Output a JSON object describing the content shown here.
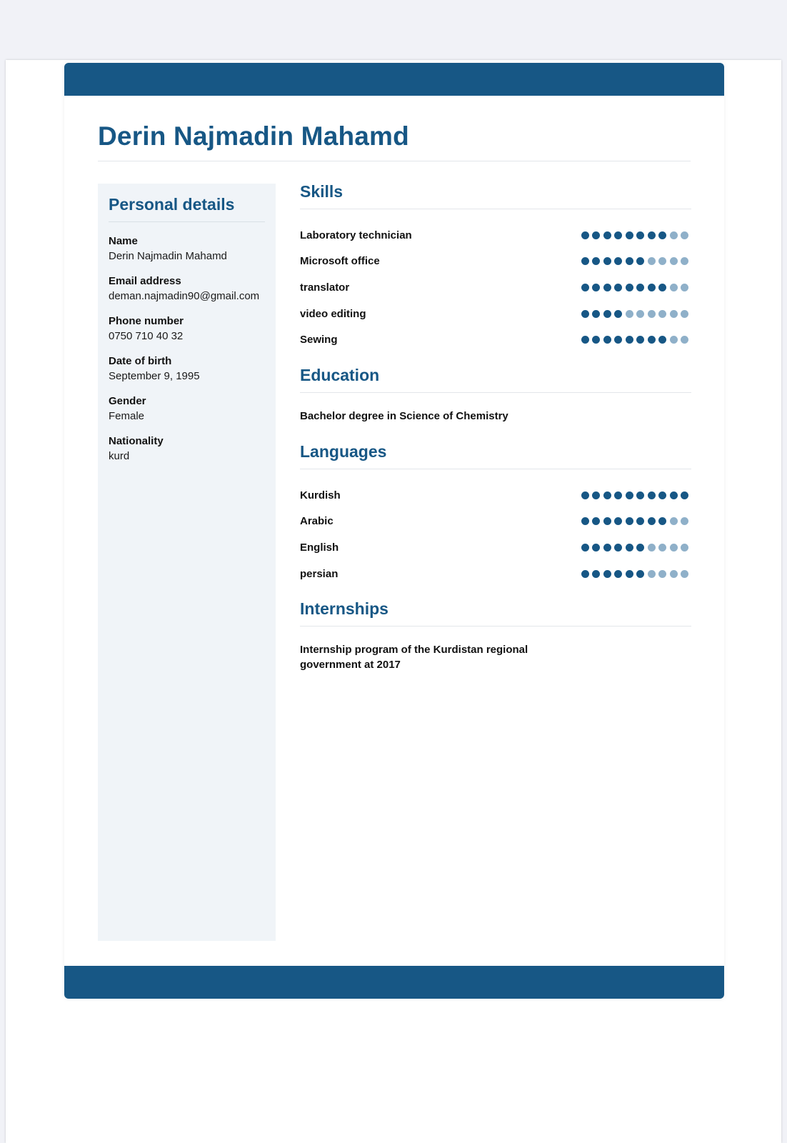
{
  "header": {
    "name": "Derin Najmadin Mahamd"
  },
  "personal": {
    "title": "Personal details",
    "items": [
      {
        "label": "Name",
        "value": "Derin Najmadin Mahamd"
      },
      {
        "label": "Email address",
        "value": "deman.najmadin90@gmail.com"
      },
      {
        "label": "Phone number",
        "value": "0750 710 40 32"
      },
      {
        "label": "Date of birth",
        "value": "September 9, 1995"
      },
      {
        "label": "Gender",
        "value": "Female"
      },
      {
        "label": "Nationality",
        "value": "kurd"
      }
    ]
  },
  "skills": {
    "title": "Skills",
    "max": 10,
    "items": [
      {
        "label": "Laboratory technician",
        "level": 8
      },
      {
        "label": "Microsoft office",
        "level": 6
      },
      {
        "label": "translator",
        "level": 8
      },
      {
        "label": "video editing",
        "level": 4
      },
      {
        "label": "Sewing",
        "level": 8
      }
    ]
  },
  "education": {
    "title": "Education",
    "entry": "Bachelor degree in Science of Chemistry"
  },
  "languages": {
    "title": "Languages",
    "max": 10,
    "items": [
      {
        "label": "Kurdish",
        "level": 10
      },
      {
        "label": "Arabic",
        "level": 8
      },
      {
        "label": "English",
        "level": 6
      },
      {
        "label": "persian",
        "level": 6
      }
    ]
  },
  "internships": {
    "title": "Internships",
    "entry": "Internship program of the Kurdistan regional government at 2017"
  },
  "colors": {
    "accent": "#175785",
    "dot_off": "#8fb0c9",
    "sidebar_bg": "#f0f4f8"
  }
}
